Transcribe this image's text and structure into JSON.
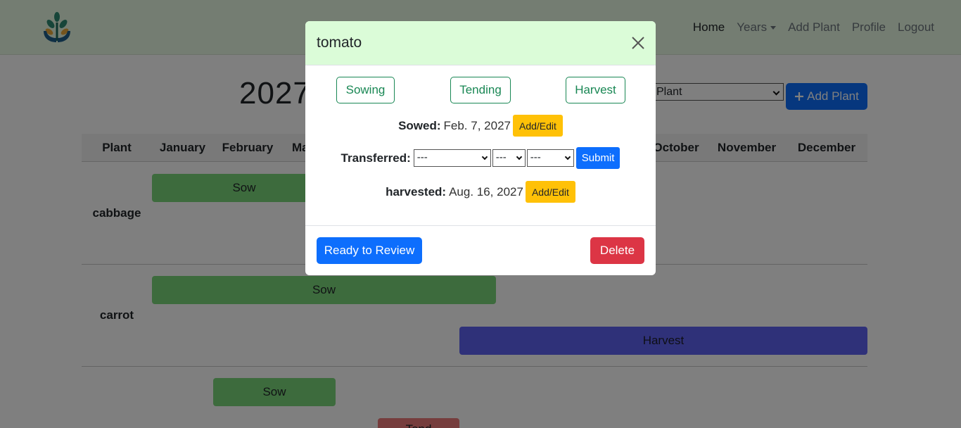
{
  "navbar": {
    "links": {
      "home": "Home",
      "years": "Years",
      "add_plant": "Add Plant",
      "profile": "Profile",
      "logout": "Logout"
    }
  },
  "page": {
    "year_title": "2027",
    "plant_select_value": "Plant",
    "add_plant_button": "Add Plant"
  },
  "table": {
    "headers": {
      "plant": "Plant",
      "january": "January",
      "february": "February",
      "march": "Ma",
      "october": "October",
      "november": "November",
      "december": "December"
    },
    "rows": [
      {
        "name": "cabbage",
        "bars": {
          "sow": "Sow"
        }
      },
      {
        "name": "carrot",
        "bars": {
          "sow": "Sow",
          "harvest": "Harvest"
        }
      },
      {
        "name": "",
        "bars": {
          "sow": "Sow",
          "tend": "Tend"
        }
      }
    ]
  },
  "modal": {
    "title": "tomato",
    "stages": {
      "sowing": "Sowing",
      "tending": "Tending",
      "harvest": "Harvest"
    },
    "sowed": {
      "label": "Sowed:",
      "value": "Feb. 7, 2027",
      "button": "Add/Edit"
    },
    "transferred": {
      "label": "Transferred:",
      "select_1": "---",
      "select_2": "---",
      "select_3": "---",
      "submit": "Submit"
    },
    "harvested": {
      "label": "harvested:",
      "value": "Aug. 16, 2027",
      "button": "Add/Edit"
    },
    "footer": {
      "review": "Ready to Review",
      "delete": "Delete"
    }
  },
  "colors": {
    "navbar_bg": "#e8fbe5",
    "modal_header_bg": "#dbfcd8",
    "primary": "#0d6efd",
    "success": "#198754",
    "warning": "#ffc107",
    "danger": "#dc3545",
    "sow_bar": "#7bd67b",
    "harvest_bar": "#5f63f2",
    "tend_bar": "#ec7b7b"
  },
  "icons": {
    "logo": "plant-hands-logo",
    "close": "close-icon",
    "plus": "plus-icon",
    "caret": "caret-down-icon"
  }
}
